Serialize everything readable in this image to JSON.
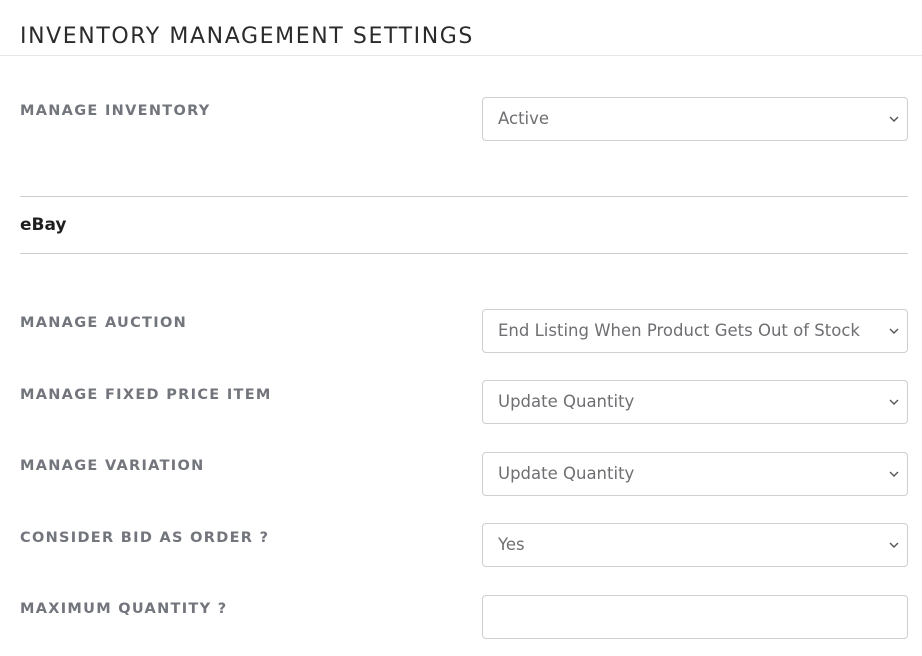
{
  "header": {
    "title": "INVENTORY MANAGEMENT SETTINGS"
  },
  "general": {
    "manage_inventory": {
      "label": "MANAGE INVENTORY",
      "value": "Active",
      "icon": "chevron-down-icon"
    }
  },
  "ebay": {
    "section_title": "eBay",
    "fields": {
      "manage_auction": {
        "label": "MANAGE AUCTION",
        "value": "End Listing When Product Gets Out of Stock",
        "icon": "chevron-down-icon"
      },
      "manage_fixed_price_item": {
        "label": "MANAGE FIXED PRICE ITEM",
        "value": "Update Quantity",
        "icon": "chevron-down-icon"
      },
      "manage_variation": {
        "label": "MANAGE VARIATION",
        "value": "Update Quantity",
        "icon": "chevron-down-icon"
      },
      "consider_bid_as_order": {
        "label": "CONSIDER BID AS ORDER ?",
        "value": "Yes",
        "icon": "chevron-down-icon"
      },
      "maximum_quantity": {
        "label": "MAXIMUM QUANTITY ?",
        "value": "",
        "placeholder": ""
      }
    }
  }
}
